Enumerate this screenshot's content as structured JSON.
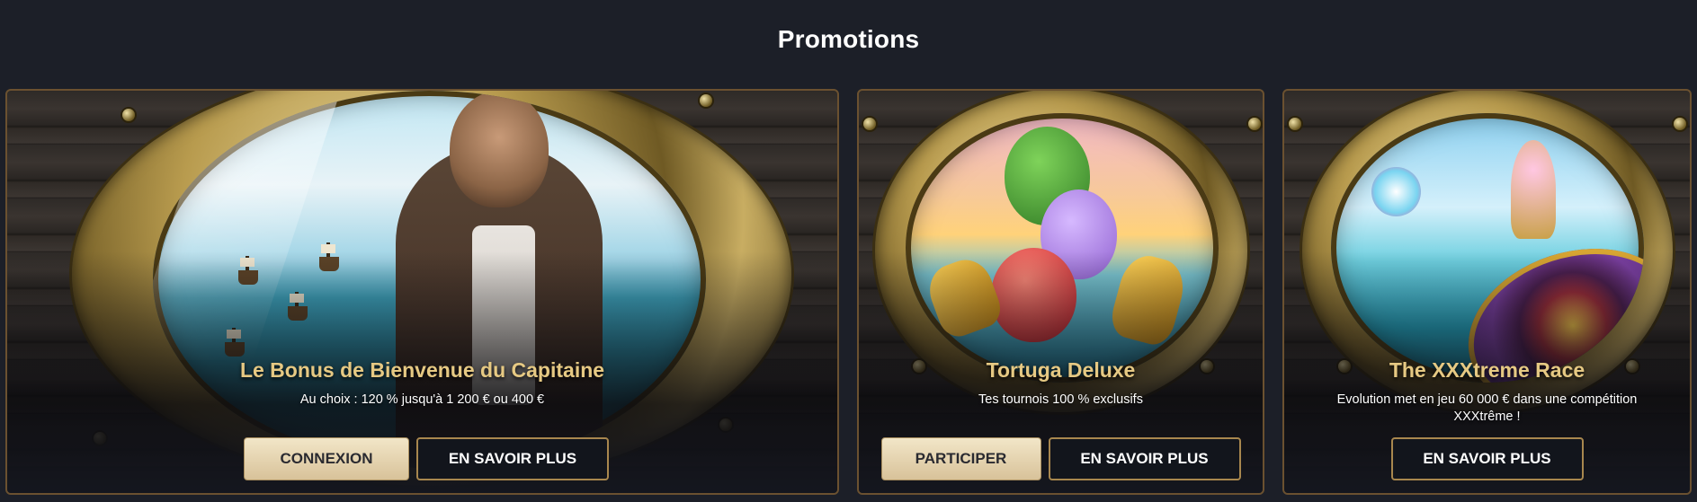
{
  "section": {
    "title": "Promotions"
  },
  "cards": [
    {
      "title": "Le Bonus de Bienvenue du Capitaine",
      "description": "Au choix : 120 % jusqu'à 1 200 € ou 400 €",
      "primary_label": "CONNEXION",
      "secondary_label": "EN SAVOIR PLUS"
    },
    {
      "title": "Tortuga Deluxe",
      "description": "Tes tournois 100 % exclusifs",
      "primary_label": "PARTICIPER",
      "secondary_label": "EN SAVOIR PLUS"
    },
    {
      "title": "The XXXtreme Race",
      "description": "Evolution met en jeu 60 000 € dans une compétition XXXtrême !",
      "secondary_label": "EN SAVOIR PLUS"
    }
  ],
  "colors": {
    "background": "#1c1f28",
    "title_gold": "#e6c983",
    "button_primary": "#e4d2ac",
    "button_border": "#a8874e"
  }
}
